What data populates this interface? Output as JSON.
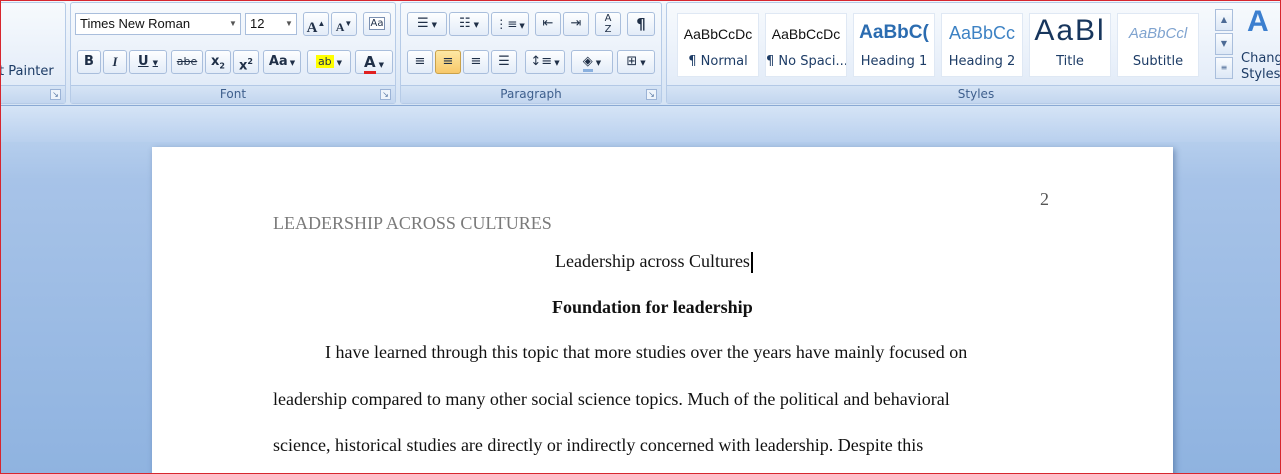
{
  "clipboard": {
    "format_painter_label": "t Painter"
  },
  "font": {
    "group_label": "Font",
    "family": "Times New Roman",
    "size": "12",
    "grow_label": "A",
    "shrink_label": "A",
    "clear_label": "Aa",
    "bold": "B",
    "italic": "I",
    "underline": "U",
    "strike": "abe",
    "subscript": "x",
    "superscript": "x",
    "change_case": "Aa",
    "highlight": "ab",
    "font_color": "A"
  },
  "paragraph": {
    "group_label": "Paragraph",
    "show_marks": "¶"
  },
  "styles": {
    "group_label": "Styles",
    "items": [
      {
        "sample": "AaBbCcDc",
        "name": "¶ Normal"
      },
      {
        "sample": "AaBbCcDc",
        "name": "¶ No Spaci..."
      },
      {
        "sample": "AaBbC(",
        "name": "Heading 1"
      },
      {
        "sample": "AaBbCc",
        "name": "Heading 2"
      },
      {
        "sample": "AaBl",
        "name": "Title"
      },
      {
        "sample": "AaBbCcl",
        "name": "Subtitle"
      }
    ],
    "change_styles_line1": "Chang",
    "change_styles_line2": "Styles"
  },
  "document": {
    "page_number": "2",
    "running_head": "LEADERSHIP ACROSS CULTURES",
    "title": "Leadership across Cultures",
    "heading": "Foundation for leadership",
    "lines": [
      "I have learned through this topic that more studies over the years have mainly focused on",
      "leadership compared to many other social science topics. Much of the political and behavioral",
      "science, historical studies are directly or indirectly concerned with leadership. Despite this"
    ]
  },
  "colors": {
    "accent_blue": "#2b579a",
    "heading_blue": "#17365d",
    "font_color_red": "#e02020",
    "highlight_yellow": "#ffff00"
  }
}
